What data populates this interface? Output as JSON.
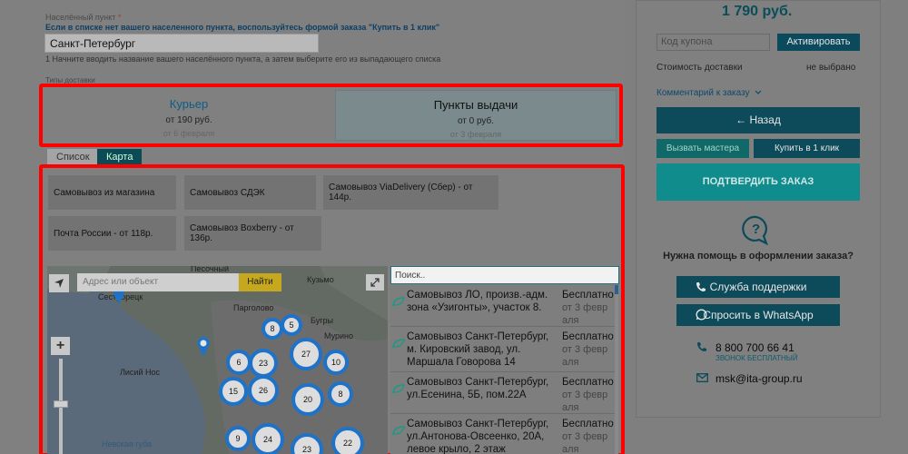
{
  "form": {
    "city_label": "Населённый пункт",
    "required_mark": "*",
    "city_hint": "Если в списке нет вашего населенного пункта, воспользуйтесь формой заказа \"Купить в 1 клик\"",
    "city_value": "Санкт-Петербург",
    "city_note": "1 Начните вводить название вашего населённого пункта, а затем выберите его из выпадающего списка",
    "delivery_types_label": "Типы доставки"
  },
  "delivery_tabs": [
    {
      "title": "Курьер",
      "price": "от 190 руб.",
      "date": "от 6 февраля"
    },
    {
      "title": "Пункты выдачи",
      "price": "от 0 руб.",
      "date": "от 3 февраля"
    }
  ],
  "view_tabs": {
    "list": "Список",
    "map": "Карта"
  },
  "pickup_options": [
    "Самовывоз из магазина",
    "Самовывоз СДЭК",
    "Самовывоз ViaDelivery (Сбер) - от 144р.",
    "Почта России - от 118р.",
    "Самовывоз Boxberry - от 136р."
  ],
  "map": {
    "address_placeholder": "Адрес или объект",
    "find_label": "Найти",
    "labels": [
      "Песочный",
      "Сестрорецк",
      "Парголово",
      "Бугры",
      "Кузьмо",
      "Мурино",
      "Лисий Нос",
      "Невская губа"
    ],
    "clusters": [
      "8",
      "5",
      "27",
      "6",
      "23",
      "10",
      "15",
      "26",
      "20",
      "8",
      "9",
      "24",
      "23",
      "22"
    ]
  },
  "list": {
    "search_placeholder": "Поиск..",
    "items": [
      {
        "name": "Самовывоз ЛО, произв.-адм. зона «Узигонты», участок 8.",
        "price": "Бесплатно",
        "date": "от 3 февр аля"
      },
      {
        "name": "Самовывоз Санкт-Петербург, м. Кировский завод, ул. Маршала Говорова 14",
        "price": "Бесплатно",
        "date": "от 3 февр аля"
      },
      {
        "name": "Самовывоз Санкт-Петербург, ул.Есенина, 5Б, пом.22А",
        "price": "Бесплатно",
        "date": "от 3 февр аля"
      },
      {
        "name": "Самовывоз Санкт-Петербург, ул.Антонова-Овсеенко, 20А, левое крыло, 2 этаж",
        "price": "Бесплатно",
        "date": "от 3 февр аля"
      }
    ]
  },
  "sidebar": {
    "total": "1 790 руб.",
    "coupon_placeholder": "Код купона",
    "activate_label": "Активировать",
    "delivery_cost_label": "Стоимость доставки",
    "delivery_cost_value": "не выбрано",
    "comment_label": "Комментарий к заказу",
    "back_label": "← Назад",
    "master_label": "Вызвать мастера",
    "one_click_label": "Купить в 1 клик",
    "confirm_label": "ПОДТВЕРДИТЬ ЗАКАЗ",
    "help_text": "Нужна помощь в оформлении заказа?",
    "support_label": "Служба поддержки",
    "whatsapp_label": "Спросить в WhatsApp",
    "phone": "8 800 700 66 41",
    "phone_sub": "ЗВОНОК БЕСПЛАТНЫЙ",
    "email": "msk@ita-group.ru"
  },
  "colors": {
    "highlight": "#ff0000",
    "primary": "#0d4a5a",
    "confirm": "#108c8c",
    "cluster_ring": "#1e72c8"
  }
}
